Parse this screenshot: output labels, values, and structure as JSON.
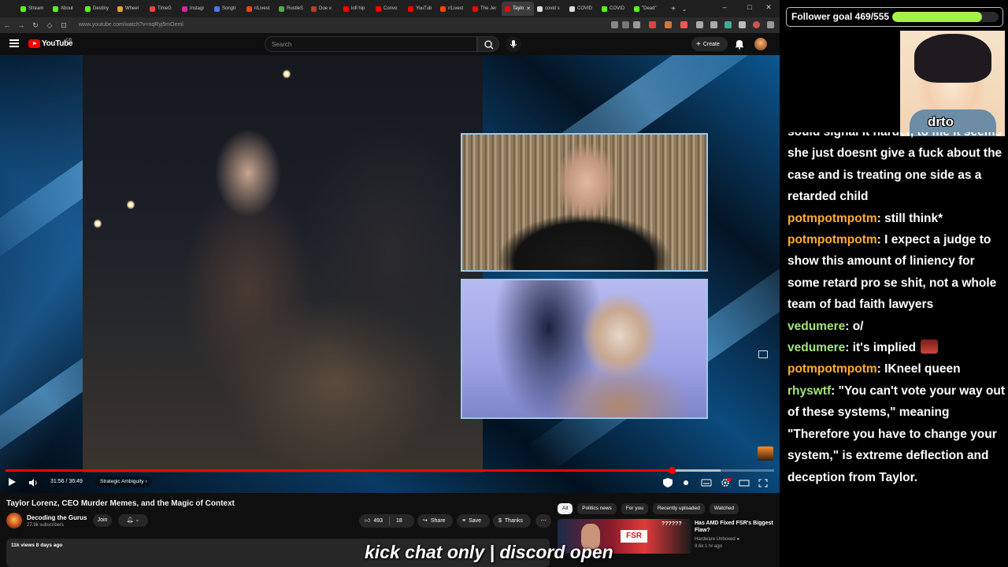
{
  "browser": {
    "tabs": [
      {
        "label": "Stream",
        "color": "#53fc18"
      },
      {
        "label": "About",
        "color": "#53fc18"
      },
      {
        "label": "Destiny",
        "color": "#53fc18"
      },
      {
        "label": "Wheel",
        "color": "#e8a23a"
      },
      {
        "label": "TimeG",
        "color": "#e84a3a"
      },
      {
        "label": "Instagr",
        "color": "#d6249f"
      },
      {
        "label": "Songtr",
        "color": "#4a7be8"
      },
      {
        "label": "r/Livest",
        "color": "#ff4500"
      },
      {
        "label": "RustleS",
        "color": "#4cae4c"
      },
      {
        "label": "Doe v.",
        "color": "#c0392b"
      },
      {
        "label": "lofi hip",
        "color": "#ff0000"
      },
      {
        "label": "Convo",
        "color": "#ff0000"
      },
      {
        "label": "YouTub",
        "color": "#ff0000"
      },
      {
        "label": "r/Livest",
        "color": "#ff4500"
      },
      {
        "label": "The Jer",
        "color": "#ff0000"
      },
      {
        "label": "Taylo",
        "color": "#ff0000",
        "active": true
      },
      {
        "label": "covid s",
        "color": "#dddddd"
      },
      {
        "label": "COVID",
        "color": "#dddddd"
      },
      {
        "label": "COVID",
        "color": "#53fc18"
      },
      {
        "label": "\"Dead\"",
        "color": "#53fc18"
      }
    ],
    "address": "www.youtube.com/watch?v=nqRyj5mOeml"
  },
  "masthead": {
    "wordmark": "YouTube",
    "country": "GB",
    "search_placeholder": "Search",
    "create_label": "Create"
  },
  "player": {
    "time": "31:56 / 36:49",
    "chapter": "Strategic Ambiguity",
    "progress_fraction": 0.867,
    "buffer_fraction": 0.93
  },
  "video": {
    "title": "Taylor Lorenz, CEO Murder Memes, and the Magic of Context",
    "channel": "Decoding the Gurus",
    "subscribers": "27.9k subscribers",
    "join_label": "Join",
    "likes": "493",
    "dislikes": "18",
    "share_label": "Share",
    "save_label": "Save",
    "thanks_label": "Thanks",
    "meta": "11k views  8 days ago"
  },
  "recommendations": {
    "chips": [
      "All",
      "Politics news",
      "For you",
      "Recently uploaded",
      "Watched"
    ],
    "item": {
      "thumb_text": "FSR",
      "thumb_question": "??????",
      "title": "Has AMD Fixed FSR's Biggest Flaw?",
      "channel": "Hardware Unboxed",
      "views": "9.6k  1 hr ago"
    }
  },
  "overlay": {
    "caption": "kick chat only | discord open"
  },
  "stream": {
    "goal_label": "Follower goal 469/555",
    "goal_current": 469,
    "goal_target": 555,
    "avatar_name": "drto",
    "chat": [
      {
        "user": "",
        "text": "sould signal it harder, to me it seems she just doesnt give a fuck about the case and is treating one side as a retarded child",
        "color": "#ffffff"
      },
      {
        "user": "potmpotmpotm",
        "text": "still think*",
        "color": "#ffad2e"
      },
      {
        "user": "potmpotmpotm",
        "text": "I expect a judge to show this amount of liniency for some retard pro se shit, not a whole team of bad faith lawyers",
        "color": "#ffad2e"
      },
      {
        "user": "vedumere",
        "text": "o/",
        "color": "#a3e37a"
      },
      {
        "user": "vedumere",
        "text": "it's implied",
        "color": "#a3e37a",
        "emote": true
      },
      {
        "user": "potmpotmpotm",
        "text": "IKneel queen",
        "color": "#ffad2e"
      },
      {
        "user": "rhyswtf",
        "text": "\"You can't vote your way out of these systems,\" meaning \"Therefore you have to change your system,\" is extreme deflection and deception from Taylor.",
        "color": "#a3e37a"
      }
    ]
  }
}
